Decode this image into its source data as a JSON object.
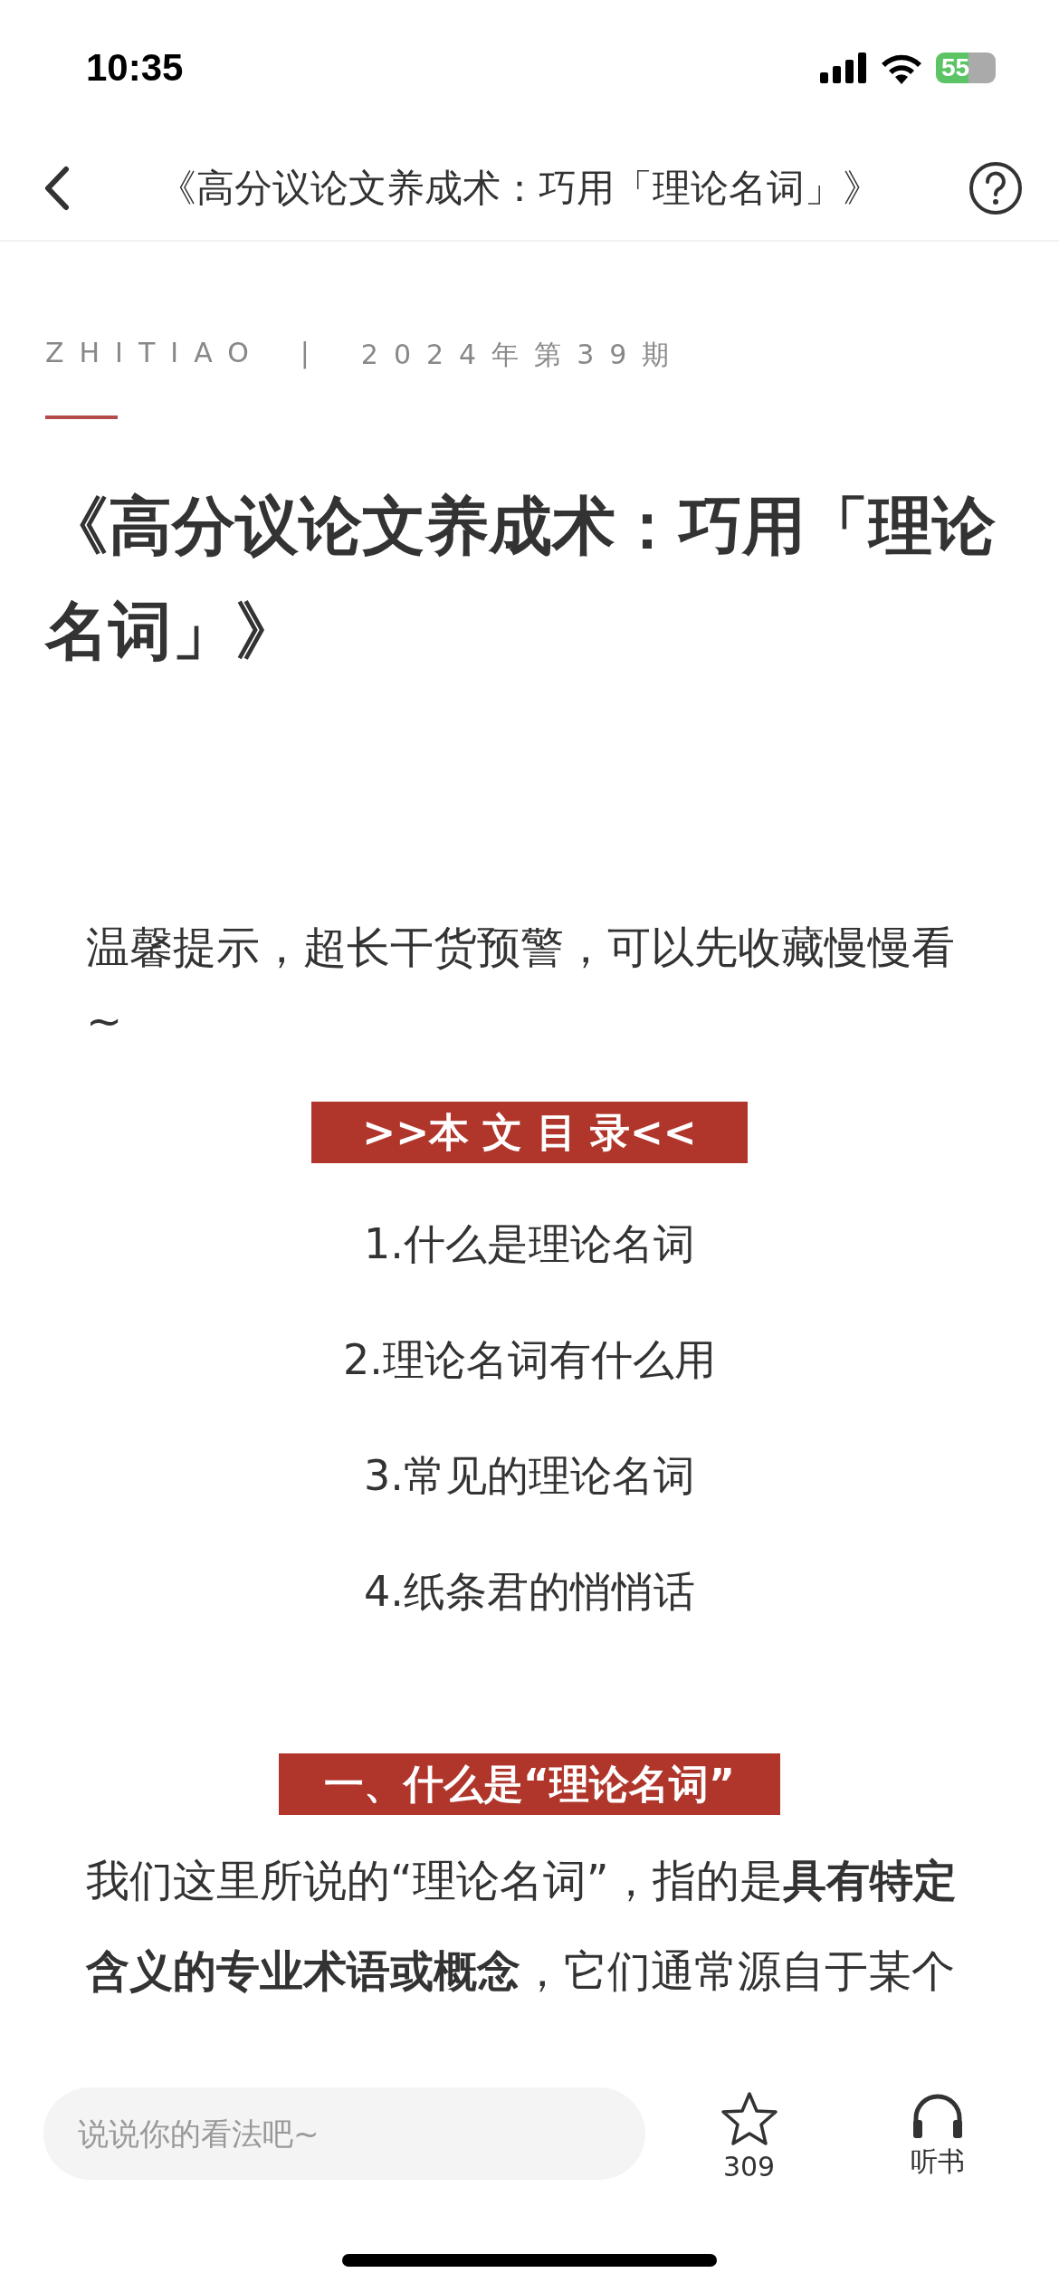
{
  "status_bar": {
    "time": "10:35",
    "battery": "55"
  },
  "nav": {
    "title": "《高分议论文养成术：巧用「理论名词」》"
  },
  "meta": {
    "brand": "ZHITIAO",
    "separator": "|",
    "issue": "2024年第39期"
  },
  "article": {
    "title": "《高分议论文养成术：巧用「理论名词」》",
    "hint": "温馨提示，超长干货预警，可以先收藏慢慢看~",
    "toc_heading": ">>本 文 目 录<<",
    "toc": [
      "1.什么是理论名词",
      "2.理论名词有什么用",
      "3.常见的理论名词",
      "4.纸条君的悄悄话"
    ],
    "section_heading": "一、什么是“理论名词”",
    "paragraph": "我们这里所说的“理论名词”，指的是**具有特定含义的专业术语或概念**，它们通常源自于某个"
  },
  "bottom_bar": {
    "comment": {
      "placeholder": "说说你的看法吧~"
    },
    "favorite_count": "309",
    "listen_label": "听书"
  }
}
